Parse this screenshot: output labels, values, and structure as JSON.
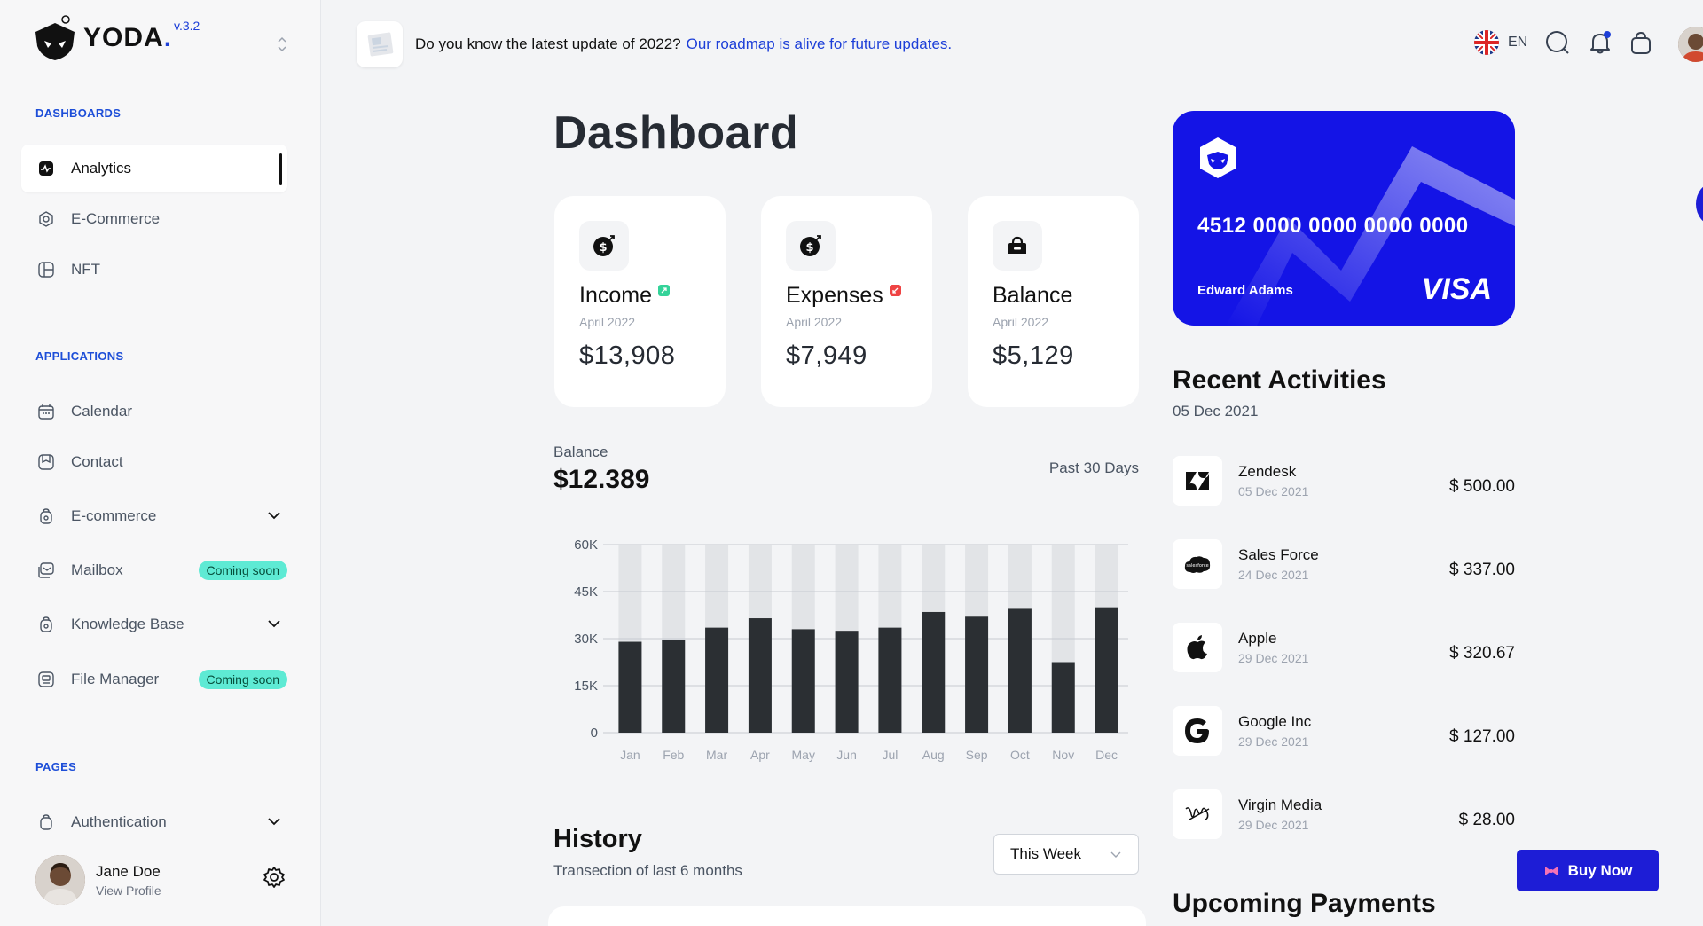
{
  "app": {
    "name": "YODA",
    "dot": ".",
    "version": "v.3.2"
  },
  "sidebar": {
    "sections": [
      {
        "title": "DASHBOARDS"
      },
      {
        "title": "APPLICATIONS"
      },
      {
        "title": "PAGES"
      }
    ],
    "items": [
      {
        "label": "Analytics"
      },
      {
        "label": "E-Commerce"
      },
      {
        "label": "NFT"
      },
      {
        "label": "Calendar"
      },
      {
        "label": "Contact"
      },
      {
        "label": "E-commerce"
      },
      {
        "label": "Mailbox",
        "badge": "Coming soon"
      },
      {
        "label": "Knowledge Base"
      },
      {
        "label": "File Manager",
        "badge": "Coming soon"
      },
      {
        "label": "Authentication"
      }
    ],
    "user": {
      "name": "Jane Doe",
      "sub": "View Profile"
    }
  },
  "topbar": {
    "notice": "Do you know the latest update of 2022?",
    "notice_link": "Our roadmap is alive for future updates.",
    "language": "EN"
  },
  "main": {
    "title": "Dashboard",
    "stats": [
      {
        "name": "Income",
        "date": "April 2022",
        "value": "$13,908",
        "mark_color": "#34d399"
      },
      {
        "name": "Expenses",
        "date": "April 2022",
        "value": "$7,949",
        "mark_color": "#ef4444"
      },
      {
        "name": "Balance",
        "date": "April 2022",
        "value": "$5,129"
      }
    ],
    "balance": {
      "label": "Balance",
      "value": "$12.389",
      "range": "Past 30 Days"
    },
    "history": {
      "title": "History",
      "subtitle": "Transection of last 6 months",
      "select": "This Week"
    }
  },
  "chart_data": {
    "type": "bar",
    "categories": [
      "Jan",
      "Feb",
      "Mar",
      "Apr",
      "May",
      "Jun",
      "Jul",
      "Aug",
      "Sep",
      "Oct",
      "Nov",
      "Dec"
    ],
    "values": [
      29000,
      29500,
      33500,
      36500,
      33000,
      32500,
      33500,
      38500,
      37000,
      39500,
      22500,
      40000
    ],
    "background_values": [
      60000,
      60000,
      60000,
      60000,
      60000,
      60000,
      60000,
      60000,
      60000,
      60000,
      60000,
      60000
    ],
    "yticks": [
      "0",
      "15K",
      "30K",
      "45K",
      "60K"
    ],
    "ylim": [
      0,
      60000
    ],
    "grid": true,
    "bar_color": "#2b2f33",
    "bg_bar_color": "#e2e4e7"
  },
  "card": {
    "number": "4512 0000 0000 0000 0000",
    "holder": "Edward Adams",
    "brand": "VISA",
    "color": "#1414e6"
  },
  "activities": {
    "title": "Recent Activities",
    "date": "05 Dec 2021",
    "items": [
      {
        "name": "Zendesk",
        "date": "05 Dec 2021",
        "amount": "$ 500.00",
        "icon": "zendesk-icon"
      },
      {
        "name": "Sales Force",
        "date": "24 Dec 2021",
        "amount": "$ 337.00",
        "icon": "salesforce-icon"
      },
      {
        "name": "Apple",
        "date": "29 Dec 2021",
        "amount": "$ 320.67",
        "icon": "apple-icon"
      },
      {
        "name": "Google Inc",
        "date": "29 Dec 2021",
        "amount": "$ 127.00",
        "icon": "google-icon"
      },
      {
        "name": "Virgin Media",
        "date": "29 Dec 2021",
        "amount": "$ 28.00",
        "icon": "virgin-icon"
      }
    ]
  },
  "upcoming": {
    "title": "Upcoming Payments"
  },
  "buy_now": {
    "label": "Buy Now"
  }
}
